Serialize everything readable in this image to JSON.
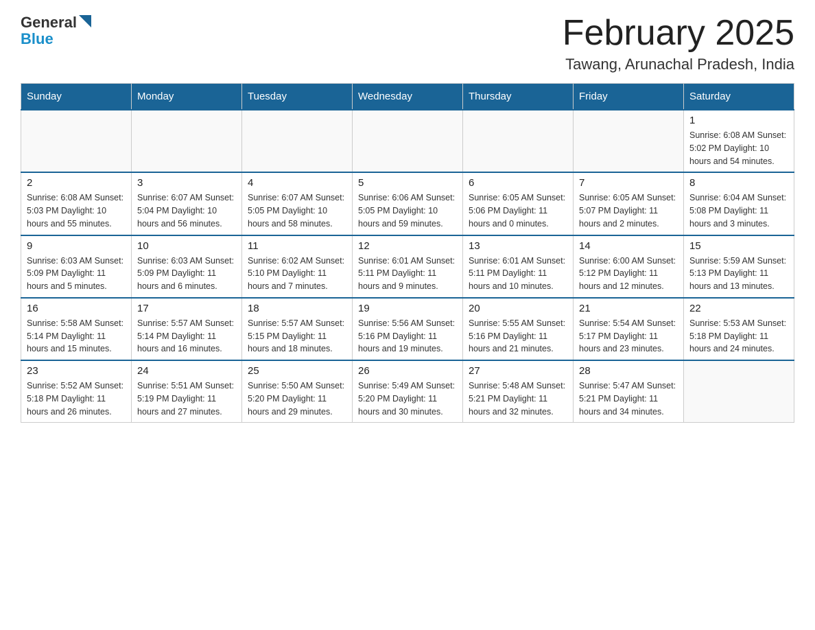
{
  "logo": {
    "general": "General",
    "blue": "Blue",
    "arrow_color": "#1a6496"
  },
  "title": "February 2025",
  "subtitle": "Tawang, Arunachal Pradesh, India",
  "weekdays": [
    "Sunday",
    "Monday",
    "Tuesday",
    "Wednesday",
    "Thursday",
    "Friday",
    "Saturday"
  ],
  "weeks": [
    [
      {
        "day": "",
        "info": ""
      },
      {
        "day": "",
        "info": ""
      },
      {
        "day": "",
        "info": ""
      },
      {
        "day": "",
        "info": ""
      },
      {
        "day": "",
        "info": ""
      },
      {
        "day": "",
        "info": ""
      },
      {
        "day": "1",
        "info": "Sunrise: 6:08 AM\nSunset: 5:02 PM\nDaylight: 10 hours\nand 54 minutes."
      }
    ],
    [
      {
        "day": "2",
        "info": "Sunrise: 6:08 AM\nSunset: 5:03 PM\nDaylight: 10 hours\nand 55 minutes."
      },
      {
        "day": "3",
        "info": "Sunrise: 6:07 AM\nSunset: 5:04 PM\nDaylight: 10 hours\nand 56 minutes."
      },
      {
        "day": "4",
        "info": "Sunrise: 6:07 AM\nSunset: 5:05 PM\nDaylight: 10 hours\nand 58 minutes."
      },
      {
        "day": "5",
        "info": "Sunrise: 6:06 AM\nSunset: 5:05 PM\nDaylight: 10 hours\nand 59 minutes."
      },
      {
        "day": "6",
        "info": "Sunrise: 6:05 AM\nSunset: 5:06 PM\nDaylight: 11 hours\nand 0 minutes."
      },
      {
        "day": "7",
        "info": "Sunrise: 6:05 AM\nSunset: 5:07 PM\nDaylight: 11 hours\nand 2 minutes."
      },
      {
        "day": "8",
        "info": "Sunrise: 6:04 AM\nSunset: 5:08 PM\nDaylight: 11 hours\nand 3 minutes."
      }
    ],
    [
      {
        "day": "9",
        "info": "Sunrise: 6:03 AM\nSunset: 5:09 PM\nDaylight: 11 hours\nand 5 minutes."
      },
      {
        "day": "10",
        "info": "Sunrise: 6:03 AM\nSunset: 5:09 PM\nDaylight: 11 hours\nand 6 minutes."
      },
      {
        "day": "11",
        "info": "Sunrise: 6:02 AM\nSunset: 5:10 PM\nDaylight: 11 hours\nand 7 minutes."
      },
      {
        "day": "12",
        "info": "Sunrise: 6:01 AM\nSunset: 5:11 PM\nDaylight: 11 hours\nand 9 minutes."
      },
      {
        "day": "13",
        "info": "Sunrise: 6:01 AM\nSunset: 5:11 PM\nDaylight: 11 hours\nand 10 minutes."
      },
      {
        "day": "14",
        "info": "Sunrise: 6:00 AM\nSunset: 5:12 PM\nDaylight: 11 hours\nand 12 minutes."
      },
      {
        "day": "15",
        "info": "Sunrise: 5:59 AM\nSunset: 5:13 PM\nDaylight: 11 hours\nand 13 minutes."
      }
    ],
    [
      {
        "day": "16",
        "info": "Sunrise: 5:58 AM\nSunset: 5:14 PM\nDaylight: 11 hours\nand 15 minutes."
      },
      {
        "day": "17",
        "info": "Sunrise: 5:57 AM\nSunset: 5:14 PM\nDaylight: 11 hours\nand 16 minutes."
      },
      {
        "day": "18",
        "info": "Sunrise: 5:57 AM\nSunset: 5:15 PM\nDaylight: 11 hours\nand 18 minutes."
      },
      {
        "day": "19",
        "info": "Sunrise: 5:56 AM\nSunset: 5:16 PM\nDaylight: 11 hours\nand 19 minutes."
      },
      {
        "day": "20",
        "info": "Sunrise: 5:55 AM\nSunset: 5:16 PM\nDaylight: 11 hours\nand 21 minutes."
      },
      {
        "day": "21",
        "info": "Sunrise: 5:54 AM\nSunset: 5:17 PM\nDaylight: 11 hours\nand 23 minutes."
      },
      {
        "day": "22",
        "info": "Sunrise: 5:53 AM\nSunset: 5:18 PM\nDaylight: 11 hours\nand 24 minutes."
      }
    ],
    [
      {
        "day": "23",
        "info": "Sunrise: 5:52 AM\nSunset: 5:18 PM\nDaylight: 11 hours\nand 26 minutes."
      },
      {
        "day": "24",
        "info": "Sunrise: 5:51 AM\nSunset: 5:19 PM\nDaylight: 11 hours\nand 27 minutes."
      },
      {
        "day": "25",
        "info": "Sunrise: 5:50 AM\nSunset: 5:20 PM\nDaylight: 11 hours\nand 29 minutes."
      },
      {
        "day": "26",
        "info": "Sunrise: 5:49 AM\nSunset: 5:20 PM\nDaylight: 11 hours\nand 30 minutes."
      },
      {
        "day": "27",
        "info": "Sunrise: 5:48 AM\nSunset: 5:21 PM\nDaylight: 11 hours\nand 32 minutes."
      },
      {
        "day": "28",
        "info": "Sunrise: 5:47 AM\nSunset: 5:21 PM\nDaylight: 11 hours\nand 34 minutes."
      },
      {
        "day": "",
        "info": ""
      }
    ]
  ]
}
